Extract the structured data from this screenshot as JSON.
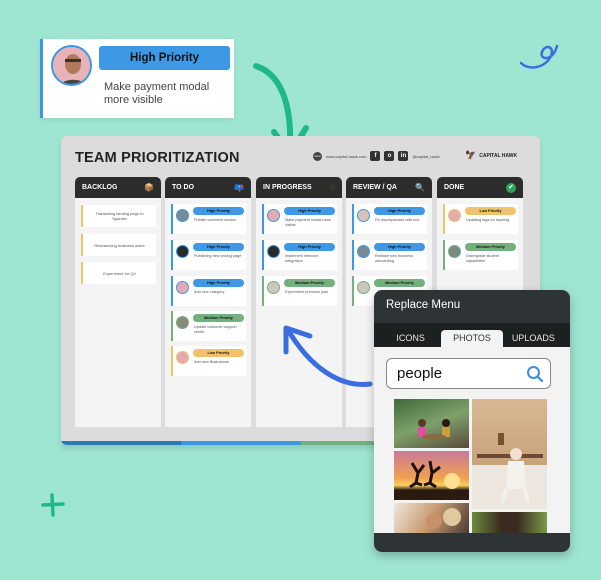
{
  "callout": {
    "priority": "High Priority",
    "task": "Make payment modal more visible",
    "avatar_icon": "person-avatar"
  },
  "board": {
    "title": "TEAM PRIORITIZATION",
    "website": "www.capital-hawk.com",
    "social_handle": "@capital_hawk",
    "social_icons": [
      "facebook-icon",
      "instagram-icon",
      "linkedin-icon"
    ],
    "social_glyphs": [
      "f",
      "o",
      "in"
    ],
    "brand": "CAPITAL HAWK",
    "columns": [
      {
        "label": "BACKLOG",
        "icon": "box-icon",
        "glyph": "📦",
        "cards": [
          {
            "task": "Translating landing page to Spanish"
          },
          {
            "task": "Researching business users"
          },
          {
            "task": "Experiment for Q4"
          }
        ]
      },
      {
        "label": "TO DO",
        "icon": "mailbox-icon",
        "glyph": "📪",
        "cards": [
          {
            "priority": "High Priority",
            "task": "Publish comment section"
          },
          {
            "priority": "High Priority",
            "task": "Publishing new pricing page"
          },
          {
            "priority": "High Priority",
            "task": "Add new category"
          },
          {
            "priority": "Medium Priority",
            "task": "Update customer support center"
          },
          {
            "priority": "Low Priority",
            "task": "Add new illustrations"
          }
        ]
      },
      {
        "label": "IN PROGRESS",
        "icon": "loading-icon",
        "glyph": "◌",
        "cards": [
          {
            "priority": "High Priority",
            "task": "Make payment modal more visible"
          },
          {
            "priority": "High Priority",
            "task": "Implement Intercom integration"
          },
          {
            "priority": "Medium Priority",
            "task": "Experiment premium plan"
          }
        ]
      },
      {
        "label": "REVIEW / QA",
        "icon": "magnifier-icon",
        "glyph": "🔍",
        "cards": [
          {
            "priority": "High Priority",
            "task": "Fix discrepancies with tool"
          },
          {
            "priority": "High Priority",
            "task": "Release new business onboarding"
          },
          {
            "priority": "Medium Priority",
            "task": ""
          }
        ]
      },
      {
        "label": "DONE",
        "icon": "check-icon",
        "glyph": "✔",
        "cards": [
          {
            "priority": "Low Priority",
            "task": "Updating tags for tracking"
          },
          {
            "priority": "Medium Priority",
            "task": "Downgrade student capabilities"
          }
        ]
      }
    ]
  },
  "colors": {
    "high": "#3d98e6",
    "medium": "#72b07e",
    "low": "#f0c36a",
    "background": "#9fe6d2"
  },
  "replace_menu": {
    "title": "Replace Menu",
    "tabs": [
      {
        "label": "ICONS",
        "active": false
      },
      {
        "label": "PHOTOS",
        "active": true
      },
      {
        "label": "UPLOADS",
        "active": false
      }
    ],
    "search_value": "people",
    "photos": [
      "two-women-outdoors-photo",
      "elderly-woman-seated-photo",
      "silhouettes-jumping-sunset-photo",
      "group-friends-photo",
      "person-on-grass-photo"
    ]
  }
}
